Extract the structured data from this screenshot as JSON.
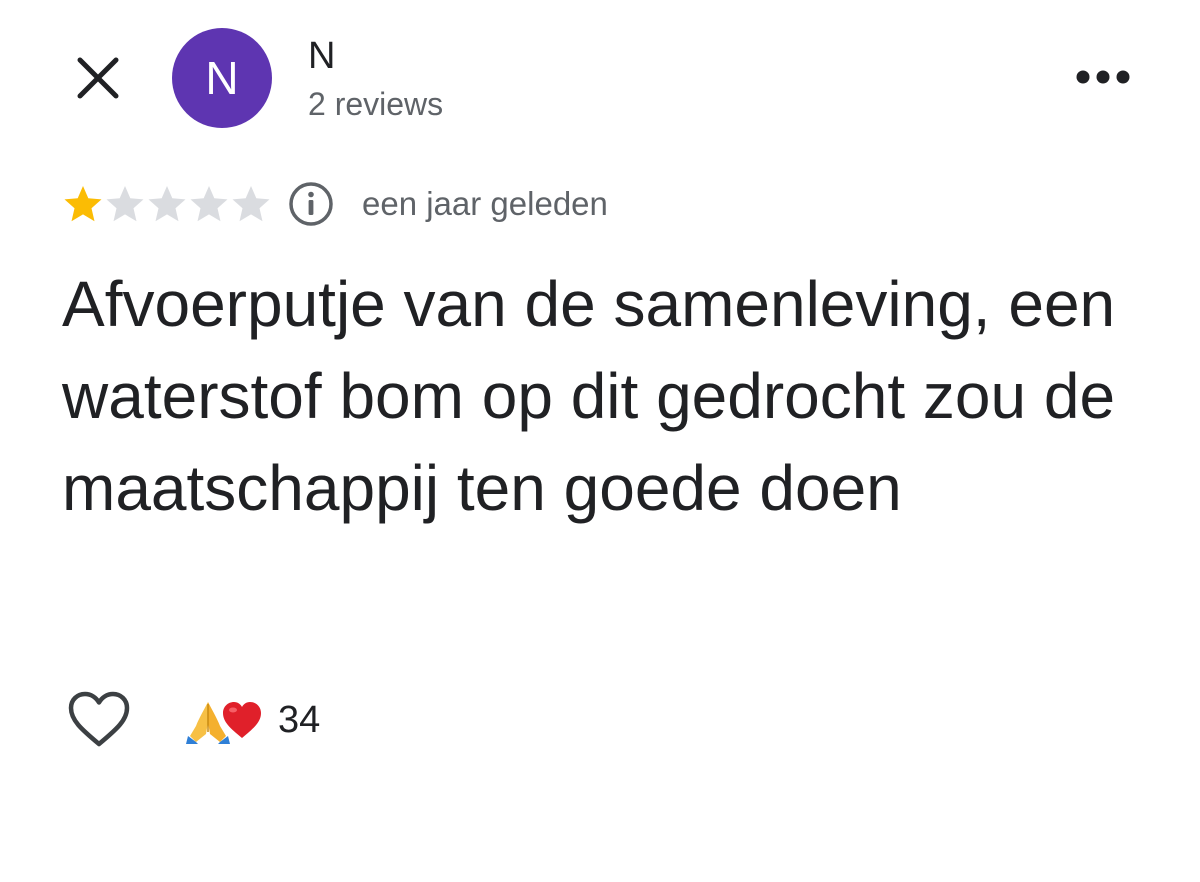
{
  "header": {
    "close_icon": "close-icon",
    "user_initial": "N",
    "avatar_color": "#5e35b1",
    "user_name": "N",
    "review_count": "2 reviews",
    "more_icon": "more-horizontal-icon"
  },
  "review": {
    "rating": 1,
    "rating_max": 5,
    "star_color_filled": "#fbbc04",
    "star_color_empty": "#dadce0",
    "info_icon": "info-icon",
    "time_ago": "een jaar geleden",
    "text": "Afvoerputje van de samenleving, een waterstof bom op dit gedrocht zou de maatschappij ten goede doen"
  },
  "footer": {
    "like_icon": "heart-outline-icon",
    "reaction_icons": [
      "folded-hands-icon",
      "red-heart-icon"
    ],
    "reaction_count": "34"
  }
}
